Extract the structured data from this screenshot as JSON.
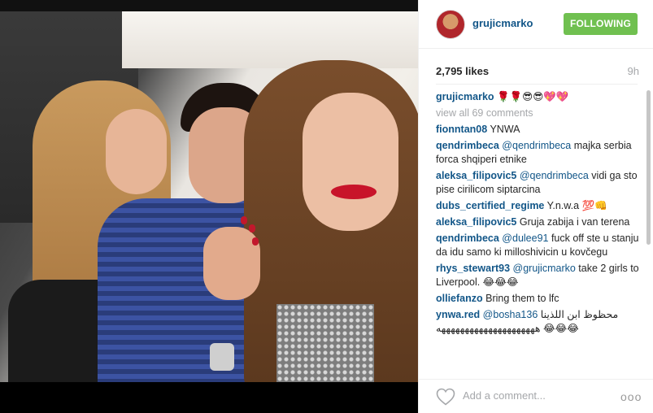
{
  "post": {
    "username": "grujicmarko",
    "follow_label": "FOLLOWING",
    "likes": "2,795 likes",
    "time_ago": "9h"
  },
  "caption": {
    "username": "grujicmarko",
    "text": "🌹🌹😎😎💖💖"
  },
  "view_all": "view all 69 comments",
  "comments": [
    {
      "user": "fionntan08",
      "mention": "",
      "text": "YNWA"
    },
    {
      "user": "qendrimbeca",
      "mention": "@qendrimbeca",
      "text": " majka serbia forca shqiperi etnike"
    },
    {
      "user": "aleksa_filipovic5",
      "mention": "@qendrimbeca",
      "text": " vidi ga sto pise cirilicom siptarcina"
    },
    {
      "user": "dubs_certified_regime",
      "mention": "",
      "text": "Y.n.w.a 💯👊"
    },
    {
      "user": "aleksa_filipovic5",
      "mention": "",
      "text": "Gruja zabija i van terena"
    },
    {
      "user": "qendrimbeca",
      "mention": "@dulee91",
      "text": " fuck off ste u stanju da idu samo ki milloshivicin u kovčegu"
    },
    {
      "user": "rhys_stewart93",
      "mention": "@grujicmarko",
      "text": " take 2 girls to Liverpool. 😂😂😂"
    },
    {
      "user": "olliefanzo",
      "mention": "",
      "text": "Bring them to lfc"
    },
    {
      "user": "ynwa.red",
      "mention": "@bosha136",
      "text": " محظوظ ابن اللذينا هههههههههههههههههههههه 😂😂😂"
    }
  ],
  "footer": {
    "add_comment_placeholder": "Add a comment...",
    "more_label": "ooo"
  },
  "colors": {
    "link": "#125688",
    "follow_button": "#70c050",
    "muted": "#a5a7aa"
  },
  "icons": {
    "like": "heart-outline-icon",
    "more": "more-options-icon"
  }
}
